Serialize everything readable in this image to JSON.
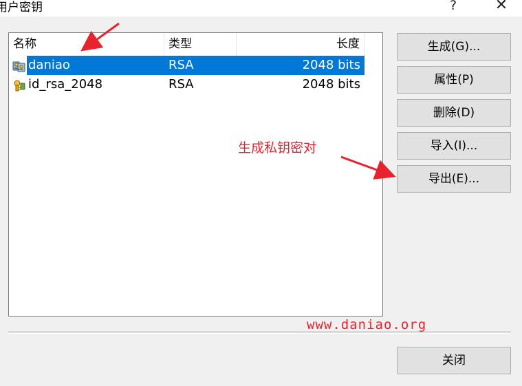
{
  "window": {
    "title": "用户密钥",
    "help_label": "?",
    "close_label": "✕"
  },
  "list": {
    "headers": {
      "name": "名称",
      "type": "类型",
      "length": "长度"
    },
    "rows": [
      {
        "name": "daniao",
        "type": "RSA",
        "length": "2048 bits",
        "icon": "key-pair-icon",
        "selected": true
      },
      {
        "name": "id_rsa_2048",
        "type": "RSA",
        "length": "2048 bits",
        "icon": "key-icon",
        "selected": false
      }
    ]
  },
  "buttons": {
    "generate": "生成(G)...",
    "properties": "属性(P)",
    "delete": "删除(D)",
    "import": "导入(I)...",
    "export": "导出(E)...",
    "close": "关闭"
  },
  "annotation": {
    "text": "生成私钥密对",
    "color": "#e8232d"
  },
  "watermark": "www.daniao.org",
  "colors": {
    "selection": "#0078d7",
    "dialog_bg": "#f0f0f0",
    "button_bg": "#e1e1e1",
    "annotation_red": "#e8232d"
  }
}
